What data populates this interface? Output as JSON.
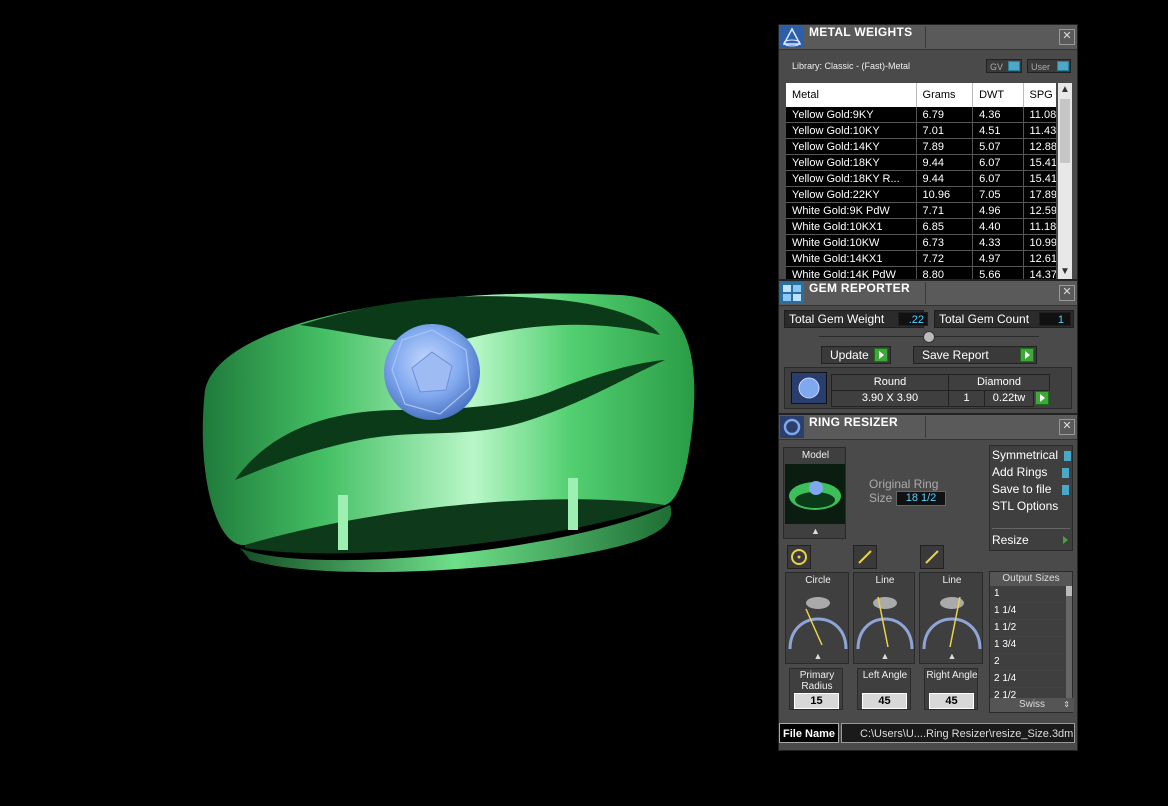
{
  "metal_weights": {
    "title": "METAL WEIGHTS",
    "library": "Library: Classic - (Fast)-Metal",
    "gv_label": "GV",
    "user_label": "User",
    "columns": [
      "Metal",
      "Grams",
      "DWT",
      "SPG"
    ],
    "rows": [
      [
        "Yellow Gold:9KY",
        "6.79",
        "4.36",
        "11.08"
      ],
      [
        "Yellow Gold:10KY",
        "7.01",
        "4.51",
        "11.43"
      ],
      [
        "Yellow Gold:14KY",
        "7.89",
        "5.07",
        "12.88"
      ],
      [
        "Yellow Gold:18KY",
        "9.44",
        "6.07",
        "15.41"
      ],
      [
        "Yellow Gold:18KY R...",
        "9.44",
        "6.07",
        "15.41"
      ],
      [
        "Yellow Gold:22KY",
        "10.96",
        "7.05",
        "17.89"
      ],
      [
        "White Gold:9K PdW",
        "7.71",
        "4.96",
        "12.59"
      ],
      [
        "White Gold:10KX1",
        "6.85",
        "4.40",
        "11.18"
      ],
      [
        "White Gold:10KW",
        "6.73",
        "4.33",
        "10.99"
      ],
      [
        "White Gold:14KX1",
        "7.72",
        "4.97",
        "12.61"
      ],
      [
        "White Gold:14K PdW",
        "8.80",
        "5.66",
        "14.37"
      ]
    ]
  },
  "gem_reporter": {
    "title": "GEM REPORTER",
    "total_weight_label": "Total Gem Weight",
    "total_weight_value": ".22",
    "total_count_label": "Total Gem Count",
    "total_count_value": "1",
    "update_label": "Update",
    "save_report_label": "Save Report",
    "gem_shape": "Round",
    "gem_type": "Diamond",
    "gem_size": "3.90 X 3.90",
    "gem_qty": "1",
    "gem_tw": "0.22tw"
  },
  "ring_resizer": {
    "title": "RING  RESIZER",
    "model_label": "Model",
    "original_ring_label": "Original Ring",
    "size_label": "Size",
    "size_value": "18 1/2",
    "options": [
      "Symmetrical",
      "Add Rings",
      "Save to file",
      "STL Options"
    ],
    "resize_label": "Resize",
    "tools": [
      {
        "name": "Circle",
        "param_label": "Primary Radius",
        "value": "15"
      },
      {
        "name": "Line",
        "param_label": "Left Angle",
        "value": "45"
      },
      {
        "name": "Line",
        "param_label": "Right Angle",
        "value": "45"
      }
    ],
    "output_sizes_label": "Output Sizes",
    "output_sizes": [
      "1",
      "1 1/4",
      "1 1/2",
      "1 3/4",
      "2",
      "2 1/4",
      "2 1/2"
    ],
    "sizing_system": "Swiss",
    "file_name_label": "File Name",
    "file_name_value": "C:\\Users\\U....Ring Resizer\\resize_Size.3dm"
  },
  "colors": {
    "ring_green": "#3cbf5a",
    "gem_blue": "#7fa8ee",
    "accent_cyan": "#4aa8c8",
    "panel_gray": "#4a4a4a"
  }
}
